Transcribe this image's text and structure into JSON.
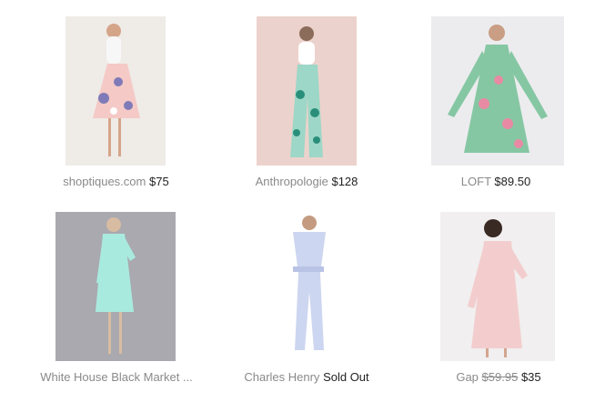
{
  "products": [
    {
      "store": "shoptiques.com",
      "price": "$75",
      "bg": "#efebe7",
      "dress": "#f4c9c6",
      "accent": "#7f7bb8"
    },
    {
      "store": "Anthropologie",
      "price": "$128",
      "bg": "#ecd2cc",
      "dress": "#9dd7c7",
      "accent": "#2a8f7a"
    },
    {
      "store": "LOFT",
      "price": "$89.50",
      "bg": "#ececef",
      "dress": "#86c7a3",
      "accent": "#e88aa3"
    },
    {
      "store": "White House Black Market ...",
      "price": "",
      "bg": "#a9a9af",
      "dress": "#a9eadf",
      "accent": "#8fd5c9"
    },
    {
      "store": "Charles Henry",
      "price": "Sold Out",
      "bg": "#ffffff",
      "dress": "#cdd6f0",
      "accent": "#b9c3e6"
    },
    {
      "store": "Gap",
      "old_price": "$59.95",
      "price": "$35",
      "bg": "#f1eff0",
      "dress": "#f3cdcd",
      "accent": "#e9b6b6"
    }
  ]
}
